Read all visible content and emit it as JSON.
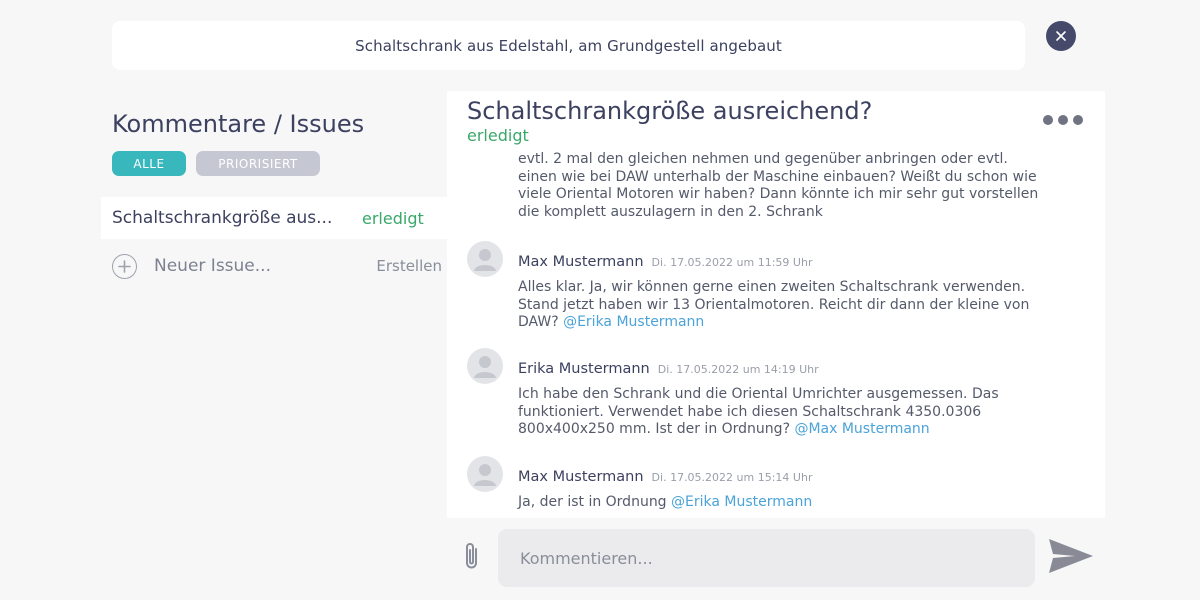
{
  "header": {
    "title": "Schaltschrank aus Edelstahl, am Grundgestell angebaut",
    "close_icon": "close-icon"
  },
  "sidebar": {
    "title": "Kommentare / Issues",
    "filters": [
      {
        "label": "ALLE",
        "active": true,
        "color": "#38b8bd"
      },
      {
        "label": "PRIORISIERT",
        "active": false,
        "color": "#c5c8d2"
      }
    ],
    "issues": [
      {
        "title": "Schaltschrankgröße aus...",
        "status": "erledigt",
        "status_color": "#3aa86a"
      }
    ],
    "new_issue": {
      "placeholder": "Neuer Issue...",
      "create_label": "Erstellen"
    }
  },
  "detail": {
    "title": "Schaltschrankgröße ausreichend?",
    "status": "erledigt",
    "more_icon": "more-horizontal-icon",
    "continuation": "evtl. 2 mal den gleichen nehmen und gegenüber anbringen oder evtl. einen wie bei DAW unterhalb der Maschine einbauen? Weißt du schon wie viele Oriental Motoren wir haben? Dann könnte ich mir sehr gut vorstellen die komplett auszulagern in den 2. Schrank",
    "comments": [
      {
        "author": "Max Mustermann",
        "timestamp": "Di. 17.05.2022 um 11:59 Uhr",
        "text": "Alles klar. Ja, wir können gerne einen zweiten Schaltschrank verwenden. Stand jetzt haben wir 13 Orientalmotoren. Reicht dir dann der kleine von DAW?",
        "mention": "@Erika Mustermann"
      },
      {
        "author": "Erika Mustermann",
        "timestamp": "Di. 17.05.2022 um 14:19 Uhr",
        "text": "Ich habe den Schrank und die Oriental Umrichter ausgemessen. Das funktioniert. Verwendet habe ich diesen Schaltschrank 4350.0306 800x400x250 mm. Ist der in Ordnung?",
        "mention": "@Max Mustermann"
      },
      {
        "author": "Max Mustermann",
        "timestamp": "Di. 17.05.2022 um 15:14 Uhr",
        "text": "Ja, der ist in Ordnung",
        "mention": "@Erika Mustermann"
      }
    ]
  },
  "composer": {
    "placeholder": "Kommentieren...",
    "attach_icon": "paperclip-icon",
    "send_icon": "send-icon"
  },
  "colors": {
    "accent": "#38b8bd",
    "status_done": "#3aa86a",
    "mention": "#4ba3d9",
    "close_button": "#454a6b"
  }
}
